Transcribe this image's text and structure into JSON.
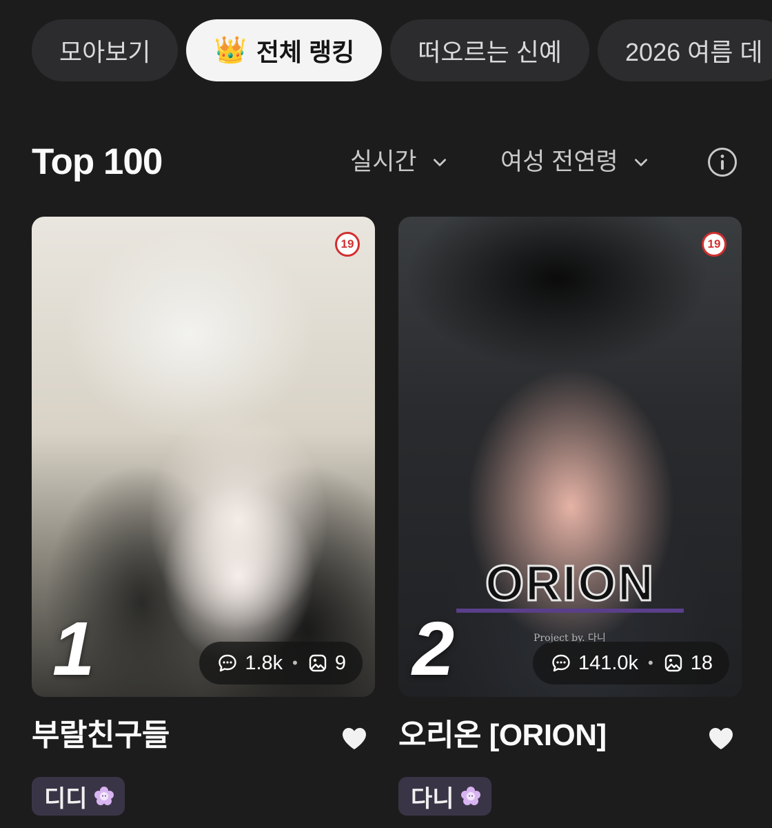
{
  "tabs": [
    {
      "label": "모아보기",
      "active": false
    },
    {
      "label": "전체 랭킹",
      "active": true,
      "icon": "crown-icon"
    },
    {
      "label": "떠오르는 신예",
      "active": false
    },
    {
      "label": "2026 여름 데",
      "active": false
    }
  ],
  "heading": {
    "title": "Top 100",
    "period_filter": "실시간",
    "demographic_filter": "여성 전연령",
    "info_icon": "info-icon"
  },
  "cards": [
    {
      "rank": "1",
      "age_badge": "19",
      "comments": "1.8k",
      "images": "9",
      "title": "부랄친구들",
      "creator": "디디"
    },
    {
      "rank": "2",
      "age_badge": "19",
      "comments": "141.0k",
      "images": "18",
      "title": "오리온 [ORION]",
      "creator": "다니",
      "cover_logo": "ORION",
      "cover_caption": "Project by. 다니"
    }
  ],
  "colors": {
    "background": "#1c1c1d",
    "tab_bg": "#2c2c2e",
    "tab_active_bg": "#f4f4f4",
    "creator_chip_bg": "#3a3546",
    "age_badge_red": "#d32f2f",
    "orion_underline": "#5a3f8a"
  }
}
